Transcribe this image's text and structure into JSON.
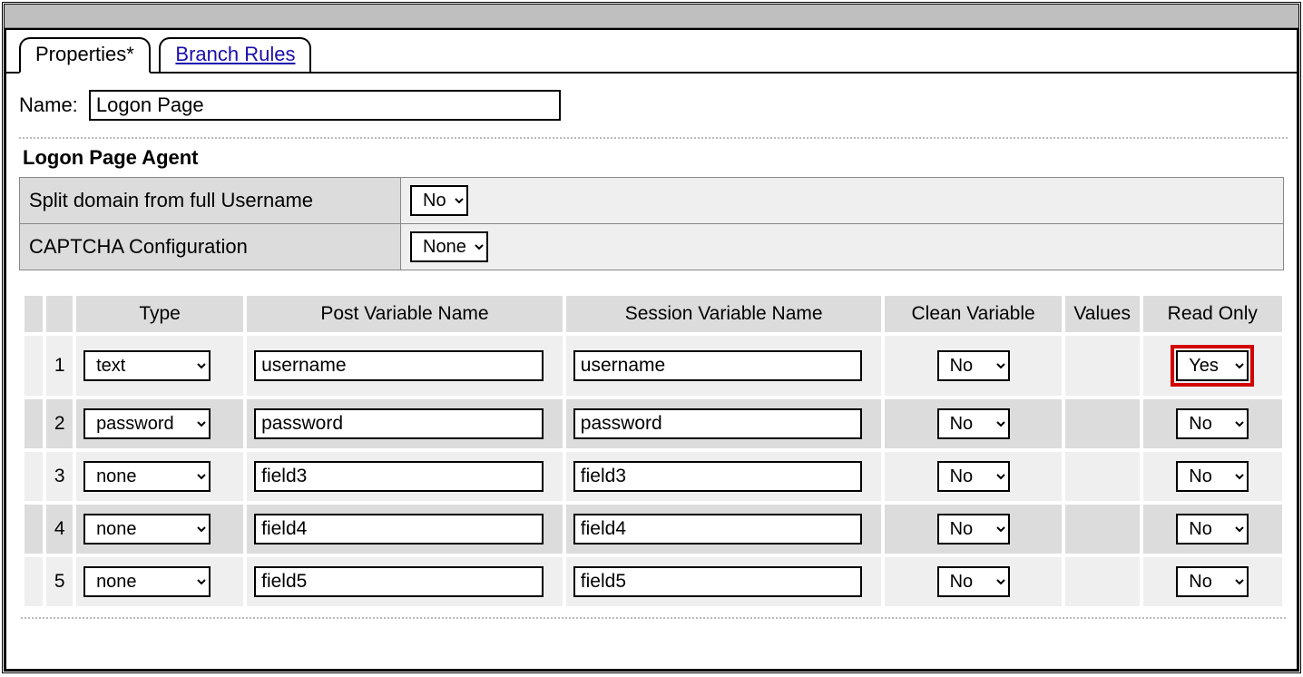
{
  "tabs": {
    "properties": "Properties*",
    "branch_rules": "Branch Rules"
  },
  "name_label": "Name:",
  "name_value": "Logon Page",
  "section_title": "Logon Page Agent",
  "agent_settings": {
    "split_domain_label": "Split domain from full Username",
    "split_domain_value": "No",
    "captcha_label": "CAPTCHA Configuration",
    "captcha_value": "None"
  },
  "columns": {
    "type": "Type",
    "post": "Post Variable Name",
    "session": "Session Variable Name",
    "clean": "Clean Variable",
    "values": "Values",
    "readonly": "Read Only"
  },
  "rows": [
    {
      "idx": "1",
      "type": "text",
      "post": "username",
      "session": "username",
      "clean": "No",
      "readonly": "Yes",
      "highlight_readonly": true
    },
    {
      "idx": "2",
      "type": "password",
      "post": "password",
      "session": "password",
      "clean": "No",
      "readonly": "No",
      "highlight_readonly": false
    },
    {
      "idx": "3",
      "type": "none",
      "post": "field3",
      "session": "field3",
      "clean": "No",
      "readonly": "No",
      "highlight_readonly": false
    },
    {
      "idx": "4",
      "type": "none",
      "post": "field4",
      "session": "field4",
      "clean": "No",
      "readonly": "No",
      "highlight_readonly": false
    },
    {
      "idx": "5",
      "type": "none",
      "post": "field5",
      "session": "field5",
      "clean": "No",
      "readonly": "No",
      "highlight_readonly": false
    }
  ]
}
